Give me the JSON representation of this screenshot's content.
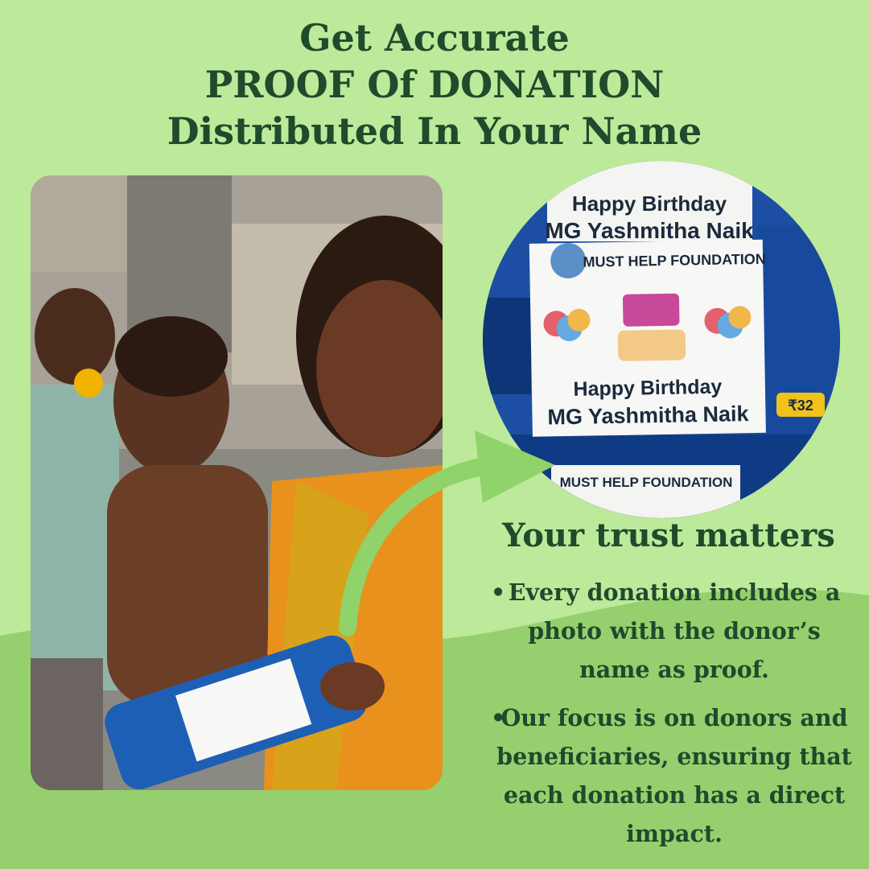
{
  "headline": {
    "line1": "Get Accurate",
    "line2": "PROOF Of DONATION",
    "line3": "Distributed In Your Name"
  },
  "photo_label": {
    "foundation": "MUST HELP FOUNDATION",
    "greeting": "Happy Birthday",
    "donor_name": "MG Yashmitha Naik",
    "price_tag": "₹32"
  },
  "trust_section": {
    "title": "Your trust matters",
    "bullet_1": "Every donation includes a photo with the donor’s name as proof.",
    "bullet_2": "Our focus is on donors and beneficiaries, ensuring that each donation has a direct impact."
  },
  "colors": {
    "background": "#bde99a",
    "wave": "#96d06e",
    "text": "#1f4a2c",
    "arrow": "#8fd36a"
  }
}
